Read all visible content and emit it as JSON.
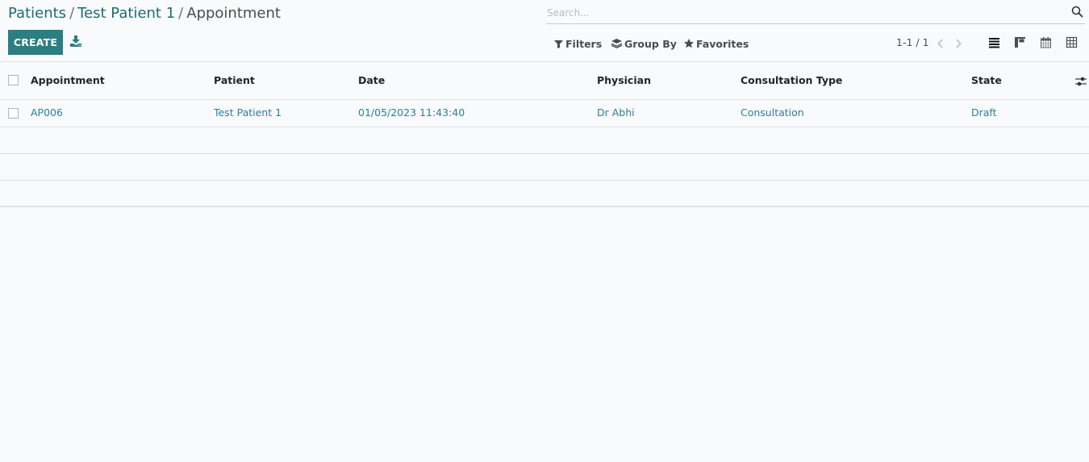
{
  "breadcrumb": {
    "items": [
      {
        "label": "Patients",
        "link": true
      },
      {
        "label": "Test Patient 1",
        "link": true
      },
      {
        "label": "Appointment",
        "link": false
      }
    ],
    "separator": "/"
  },
  "toolbar": {
    "create_label": "CREATE",
    "download_icon": "download-icon"
  },
  "search": {
    "placeholder": "Search...",
    "value": "",
    "icon": "search-icon"
  },
  "filters": {
    "filters_label": "Filters",
    "group_by_label": "Group By",
    "favorites_label": "Favorites"
  },
  "pager": {
    "value": "1-1 / 1"
  },
  "view_switcher": [
    "list",
    "kanban",
    "calendar",
    "pivot"
  ],
  "colors": {
    "primary": "#2b7e82",
    "link": "#2a7f9e",
    "breadcrumb_link": "#1f6b72",
    "background": "#f9fafb"
  },
  "table": {
    "columns": [
      "Appointment",
      "Patient",
      "Date",
      "Physician",
      "Consultation Type",
      "State"
    ],
    "rows": [
      {
        "appointment": "AP006",
        "patient": "Test Patient 1",
        "date": "01/05/2023 11:43:40",
        "physician": "Dr Abhi",
        "consultation_type": "Consultation",
        "state": "Draft"
      }
    ]
  }
}
